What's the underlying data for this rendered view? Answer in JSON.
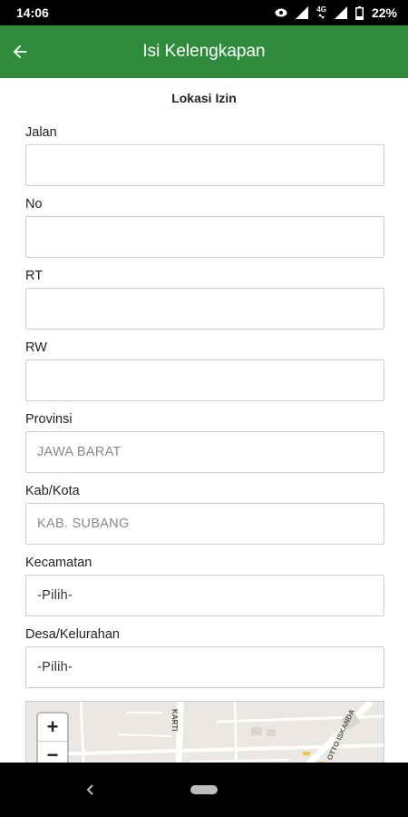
{
  "status_bar": {
    "time": "14:06",
    "network": "4G",
    "battery": "22%"
  },
  "app_bar": {
    "title": "Isi Kelengkapan",
    "back_icon": "arrow-left-icon"
  },
  "form": {
    "section_title": "Lokasi Izin",
    "fields": [
      {
        "label": "Jalan",
        "value": "",
        "placeholder": ""
      },
      {
        "label": "No",
        "value": "",
        "placeholder": ""
      },
      {
        "label": "RT",
        "value": "",
        "placeholder": ""
      },
      {
        "label": "RW",
        "value": "",
        "placeholder": ""
      },
      {
        "label": "Provinsi",
        "value": "JAWA BARAT"
      },
      {
        "label": "Kab/Kota",
        "value": "KAB. SUBANG"
      },
      {
        "label": "Kecamatan",
        "value": "-Pilih-"
      },
      {
        "label": "Desa/Kelurahan",
        "value": "-Pilih-"
      }
    ]
  },
  "map": {
    "zoom_in": "+",
    "zoom_out": "−",
    "street_labels": [
      "KARTI",
      "OTTO ISKANDA"
    ]
  },
  "colors": {
    "app_bar": "#2f8c3d",
    "status_bar": "#000000",
    "nav_bar": "#000000"
  }
}
